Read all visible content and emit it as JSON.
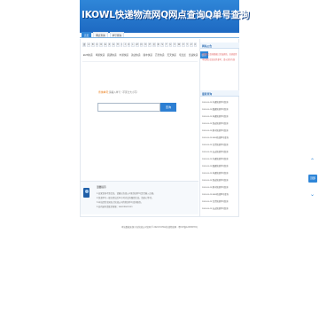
{
  "banner": {
    "title": "IKOWL快递物流网Q网点查询Q单号查询",
    "links": [
      "加入收藏",
      "设为首页",
      "快递网点大全"
    ]
  },
  "nav": {
    "tabs": [
      "首页",
      "网点查询",
      "单号查询"
    ]
  },
  "letters": [
    "首",
    "A",
    "B",
    "C",
    "D",
    "E",
    "F",
    "G",
    "H",
    "I",
    "J",
    "K",
    "L",
    "M",
    "N",
    "O",
    "P",
    "Q",
    "R",
    "S",
    "T",
    "U",
    "V",
    "W",
    "X",
    "Y",
    "Z",
    "0"
  ],
  "companies": [
    "EMS快递",
    "申通快递",
    "圆通快递",
    "中通快递",
    "韵达快递",
    "顺丰快递",
    "百世快递",
    "天天快递",
    "宅急送",
    "优速快递",
    "德邦"
  ],
  "tracking": {
    "label": "查询单号：",
    "hint": "请输入单号（不区分大小写）",
    "placeholder": "",
    "button": "查询"
  },
  "info": {
    "title": "温馨提示",
    "lines": [
      "1.如果查询不到信息，请确认快递公司和快递单号是否输入正确。",
      "2.快递单号一般在寄出后24小时内会有跟踪信息，请耐心等待。",
      "3.本站提供全国各大快递公司的物流单号查询服务。",
      "4.如有疑问请联系客服：www.ikowl.com"
    ]
  },
  "sidebar": {
    "notice_title": "网站公告",
    "notices": [
      "快递网点查询数据已全面更新，欢迎使用",
      "本站网点信息仅供参考，请以实际为准"
    ],
    "recent_title": "最新查询",
    "recent": [
      "2024-05-23 中通快递单号查询",
      "2024-05-23 圆通快递单号查询",
      "2024-05-23 申通快递单号查询",
      "2024-05-23 韵达快递单号查询",
      "2024-05-23 顺丰快递单号查询",
      "2024-05-23 EMS快递单号查询",
      "2024-05-23 百世快递单号查询",
      "2024-05-23 天天快递单号查询",
      "2024-05-23 中通快递单号查询",
      "2024-05-23 圆通快递单号查询",
      "2024-05-23 申通快递单号查询",
      "2024-05-23 韵达快递单号查询",
      "2024-05-23 顺丰快递单号查询",
      "2024-05-23 EMS快递单号查询",
      "2024-05-23 百世快递单号查询",
      "2024-05-23 天天快递单号查询"
    ]
  },
  "footer": {
    "text": "本站数据来源于各快递公司官网 © 2024 IKOWL快递物流网 · 粤ICP备12345678号"
  },
  "float_widget": {
    "label": "顶部"
  }
}
